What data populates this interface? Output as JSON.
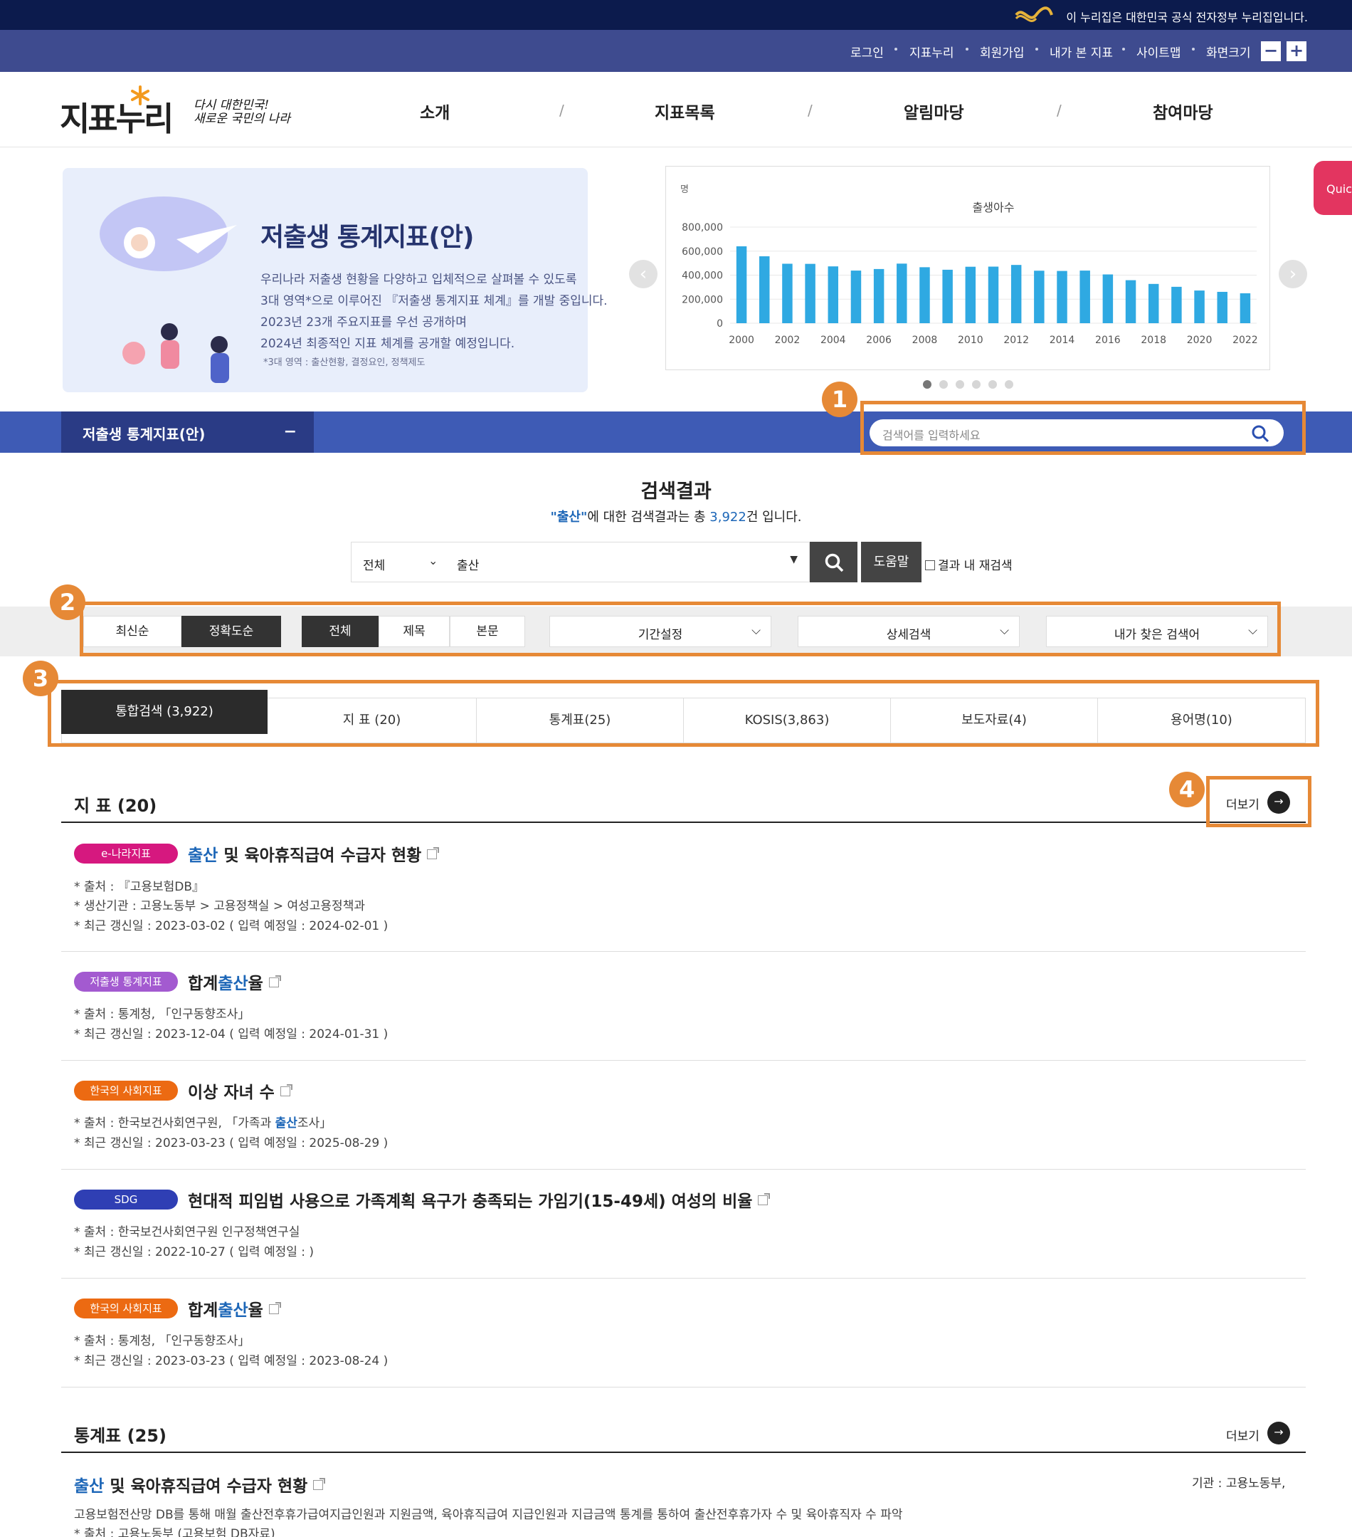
{
  "gov_banner": {
    "text": "이 누리집은 대한민국 공식 전자정부 누리집입니다."
  },
  "util_links": [
    "로그인",
    "지표누리",
    "회원가입",
    "내가 본 지표",
    "사이트맵",
    "화면크기"
  ],
  "font_size_buttons": {
    "minus": "−",
    "plus": "+"
  },
  "logo": {
    "text": "지표누리",
    "slogan_line1": "다시 대한민국!",
    "slogan_line2": "새로운 국민의 나라"
  },
  "main_menu": [
    "소개",
    "지표목록",
    "알림마당",
    "참여마당"
  ],
  "banner": {
    "title": "저출생 통계지표(안)",
    "lines": [
      "우리나라 저출생 현황을 다양하고 입체적으로 살펴볼 수 있도록",
      "3대 영역*으로 이루어진 『저출생 통계지표 체계』를 개발 중입니다.",
      "2023년 23개 주요지표를 우선 공개하며",
      "2024년 최종적인 지표 체계를 공개할 예정입니다."
    ],
    "note": "*3대 영역 : 출산현황, 결정요인, 정책제도"
  },
  "quick": {
    "label": "Quick"
  },
  "chart_data": {
    "type": "bar",
    "title": "출생아수",
    "ylabel": "명",
    "ylim": [
      0,
      800000
    ],
    "yticks": [
      "800,000",
      "600,000",
      "400,000",
      "200,000",
      "0"
    ],
    "x_tick_labels": [
      "2000",
      "2002",
      "2004",
      "2006",
      "2008",
      "2010",
      "2012",
      "2014",
      "2016",
      "2018",
      "2020",
      "2022"
    ],
    "categories": [
      "2000",
      "2001",
      "2002",
      "2003",
      "2004",
      "2005",
      "2006",
      "2007",
      "2008",
      "2009",
      "2010",
      "2011",
      "2012",
      "2013",
      "2014",
      "2015",
      "2016",
      "2017",
      "2018",
      "2019",
      "2020",
      "2021",
      "2022"
    ],
    "values": [
      640000,
      557000,
      495000,
      494000,
      473000,
      438000,
      451000,
      496000,
      466000,
      445000,
      470000,
      471000,
      485000,
      437000,
      435000,
      438000,
      406000,
      358000,
      327000,
      303000,
      272000,
      261000,
      249000
    ],
    "color": "#2fa9e2",
    "grid": true
  },
  "carousel": {
    "prev": "‹",
    "next": "›",
    "pages": 6,
    "active": 0
  },
  "sidebar_tab": {
    "label": "저출생 통계지표(안)",
    "toggle": "−"
  },
  "top_search": {
    "placeholder": "검색어를 입력하세요"
  },
  "callouts": [
    "1",
    "2",
    "3",
    "4"
  ],
  "result_header": {
    "title": "검색결과",
    "keyword": "\"출산\"",
    "mid": "에 대한 검색결과는 총 ",
    "count": "3,922",
    "tail": "건 입니다."
  },
  "search_form": {
    "scope": "전체",
    "query": "출산",
    "help_button": "도움말",
    "recheck": "결과 내 재검색"
  },
  "sort_buttons": [
    "최신순",
    "정확도순"
  ],
  "field_buttons": [
    "전체",
    "제목",
    "본문"
  ],
  "dropdowns": [
    "기간설정",
    "상세검색",
    "내가 찾은 검색어"
  ],
  "tabs": [
    "통합검색 (3,922)",
    "지 표 (20)",
    "통계표(25)",
    "KOSIS(3,863)",
    "보도자료(4)",
    "용어명(10)"
  ],
  "indicator_section": {
    "title": "지 표 (20)",
    "more": "더보기"
  },
  "indicators": [
    {
      "tag": "e-나라지표",
      "tag_color": "#d6187f",
      "title_hl": "출산",
      "title_rest": " 및 육아휴직급여 수급자 현황",
      "meta": [
        "* 출처 : 『고용보험DB』",
        "* 생산기관 : 고용노동부 > 고용정책실 > 여성고용정책과",
        "* 최근 갱신일 : 2023-03-02 ( 입력 예정일 : 2024-02-01 )"
      ]
    },
    {
      "tag": "저출생 통계지표",
      "tag_color": "#a35ad0",
      "title_pre": "합계",
      "title_hl": "출산",
      "title_rest": "율",
      "meta": [
        "* 출처 : 통계청, 「인구동향조사」",
        "* 최근 갱신일 : 2023-12-04 ( 입력 예정일 : 2024-01-31 )"
      ]
    },
    {
      "tag": "한국의 사회지표",
      "tag_color": "#ec6a12",
      "title_rest": "이상 자녀 수",
      "meta_pre": "* 출처 : 한국보건사회연구원, 「가족과 ",
      "meta_hl": "출산",
      "meta_post": "조사」",
      "meta": [
        "* 최근 갱신일 : 2023-03-23 ( 입력 예정일 : 2025-08-29 )"
      ]
    },
    {
      "tag": "SDG",
      "tag_color": "#2f3fb4",
      "title_rest": "현대적 피임법 사용으로 가족계획 욕구가 충족되는 가임기(15-49세) 여성의 비율",
      "meta": [
        "* 출처 : 한국보건사회연구원 인구정책연구실",
        "* 최근 갱신일 : 2022-10-27 ( 입력 예정일 : )"
      ]
    },
    {
      "tag": "한국의 사회지표",
      "tag_color": "#ec6a12",
      "title_pre": "합계",
      "title_hl": "출산",
      "title_rest": "율",
      "meta": [
        "* 출처 : 통계청, 「인구동향조사」",
        "* 최근 갱신일 : 2023-03-23 ( 입력 예정일 : 2023-08-24 )"
      ]
    }
  ],
  "table_section": {
    "title": "통계표 (25)",
    "more": "더보기",
    "item": {
      "title_hl": "출산",
      "title_rest": " 및 육아휴직급여 수급자 현황",
      "agency": "기관 : 고용노동부,",
      "desc": "고용보험전산망 DB를 통해 매월 출산전후휴가급여지급인원과 지원금액, 육아휴직급여 지급인원과 지급금액 통계를 통하여 출산전후휴가자 수 및 육아휴직자 수 파악",
      "source": "* 출처 : 고용노동부 (고용보험 DB자료)"
    }
  }
}
